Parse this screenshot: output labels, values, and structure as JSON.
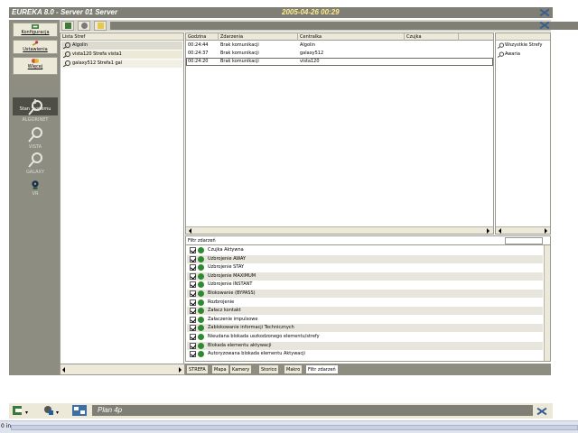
{
  "window": {
    "title": "EUREKA 8.0 - Server 01 Server",
    "datetime": "2005-04-26 00:29"
  },
  "sidebar": {
    "buttons": [
      {
        "label": "Konfiguracja"
      },
      {
        "label": "Ustawienia"
      },
      {
        "label": "Więcej"
      }
    ],
    "section_label": "Stan Systemu",
    "items": [
      {
        "label": "ALGORINET"
      },
      {
        "label": "VISTA"
      },
      {
        "label": "GALAXY"
      },
      {
        "label": "VR"
      }
    ]
  },
  "zones": {
    "header": "Lista Stref",
    "rows": [
      {
        "label": "Algolin"
      },
      {
        "label": "vista120 Strefa vista1"
      },
      {
        "label": "galaxy512 Strefa1 gal"
      }
    ]
  },
  "events": {
    "columns": [
      "Godzina",
      "Zdarzenia",
      "Centralka",
      "Czujka"
    ],
    "rows": [
      {
        "time": "00:24:44",
        "event": "Brak komunikacji",
        "panel": "Algolin",
        "sensor": ""
      },
      {
        "time": "00:24:37",
        "event": "Brak komunikacji",
        "panel": "galaxy512",
        "sensor": ""
      },
      {
        "time": "00:24:20",
        "event": "Brak komunikacji",
        "panel": "vista120",
        "sensor": ""
      }
    ]
  },
  "right_panel": {
    "rows": [
      {
        "label": "Wszystkie Strefy"
      },
      {
        "label": "Awaria"
      }
    ]
  },
  "filter": {
    "title": "Filtr zdarzeń",
    "rows": [
      "Czujka Aktywna",
      "Uzbrojenie AWAY",
      "Uzbrojenie STAY",
      "Uzbrojenie MAXIMUM",
      "Uzbrojenie INSTANT",
      "Blokowanie (BYPASS)",
      "Rozbrojenie",
      "Załacz kontakt",
      "Załaczenie impulsowe",
      "Zablokowanie informacji Technicznych",
      "Nieudana blokada uszkodzonego elementu/strefy",
      "Blokada elementu aktywacji",
      "Autoryzowana blokada elementu Aktywacji"
    ]
  },
  "tabs": [
    "STREFA",
    "Mapa",
    "Kamery",
    "Storico",
    "Makro",
    "Filtr zdarzeń"
  ],
  "taskbar": {
    "plan_label": "Plan 4p"
  },
  "status": {
    "text": "0 in"
  },
  "colors": {
    "titlebar": "#7f7f76",
    "date_text": "#ffeb8c",
    "panel_bg": "#ece9d8",
    "status_ok": "#2f8a2f"
  }
}
